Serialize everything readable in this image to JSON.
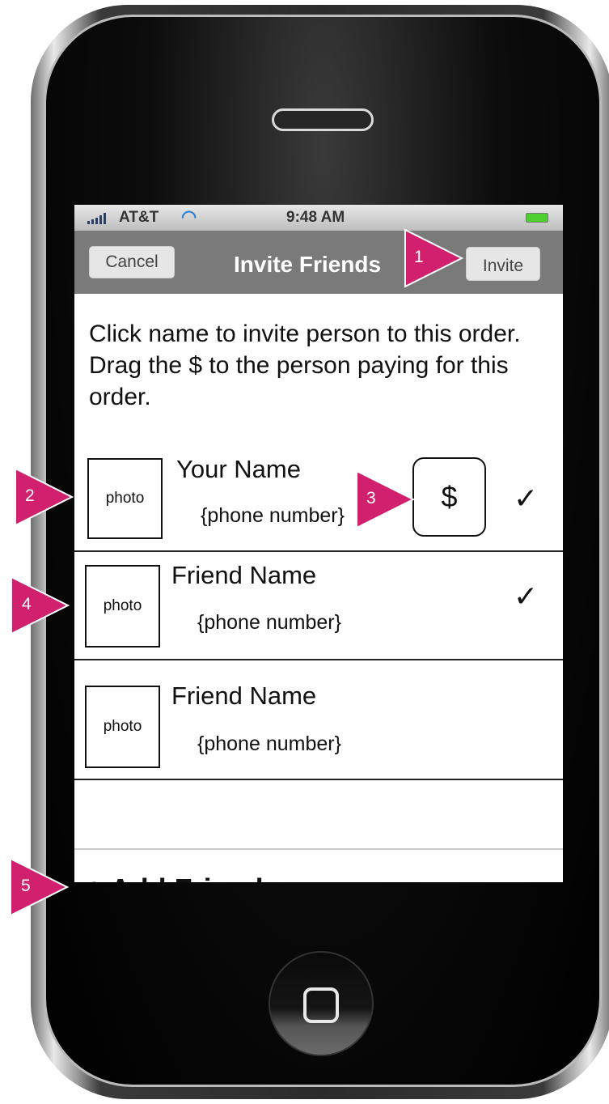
{
  "status_bar": {
    "carrier": "AT&T",
    "time": "9:48 AM",
    "signal_icon": "signal-bars-icon",
    "wifi_icon": "wifi-icon",
    "battery_icon": "battery-icon"
  },
  "nav": {
    "cancel_label": "Cancel",
    "title": "Invite Friends",
    "invite_label": "Invite"
  },
  "instructions": "Click name to invite person to this order. Drag the $ to the person paying for this order.",
  "contacts": [
    {
      "photo_label": "photo",
      "name": "Your Name",
      "phone": "{phone number}",
      "checked": true,
      "check_mark": "✓"
    },
    {
      "photo_label": "photo",
      "name": "Friend Name",
      "phone": "{phone number}",
      "checked": true,
      "check_mark": "✓"
    },
    {
      "photo_label": "photo",
      "name": "Friend Name",
      "phone": "{phone number}",
      "checked": false
    }
  ],
  "payer_token": "$",
  "add_friend": {
    "label": "+ Add Friend",
    "chevron": ">"
  },
  "annotations": [
    "1",
    "2",
    "3",
    "4",
    "5"
  ],
  "colors": {
    "annotation": "#d0206e",
    "nav_bar": "#7a7a7a"
  }
}
